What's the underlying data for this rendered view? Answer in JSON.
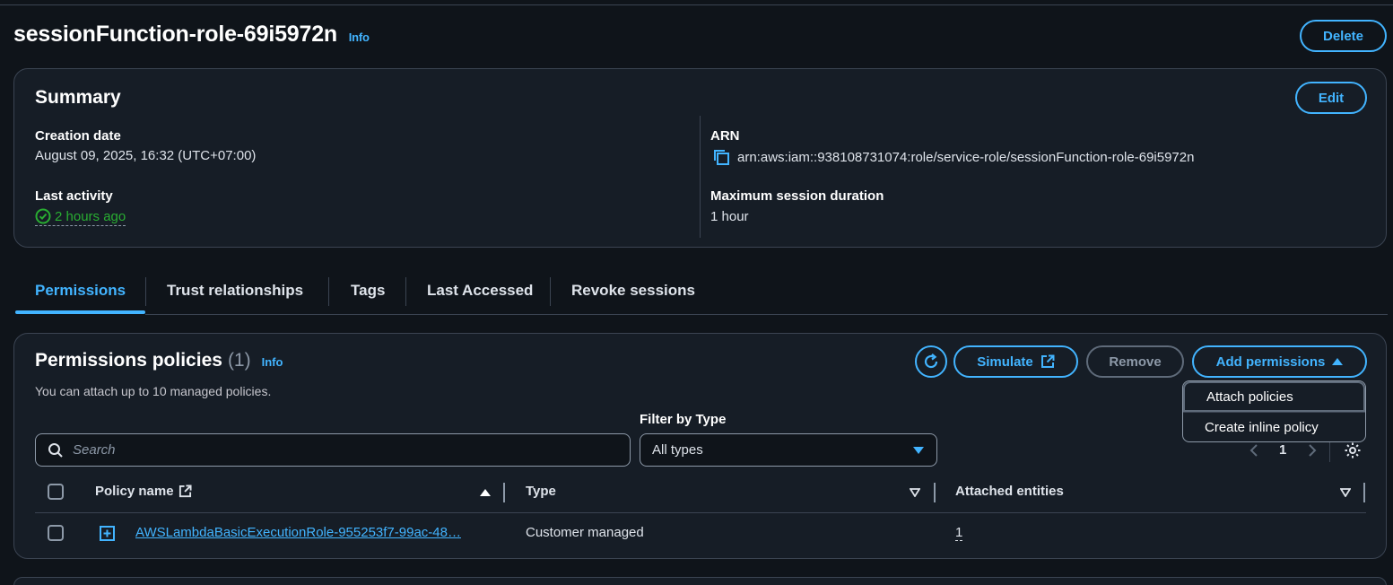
{
  "page": {
    "title": "sessionFunction-role-69i5972n",
    "info": "Info",
    "delete_label": "Delete"
  },
  "summary": {
    "title": "Summary",
    "edit_label": "Edit",
    "creation_date_label": "Creation date",
    "creation_date_value": "August 09, 2025, 16:32 (UTC+07:00)",
    "last_activity_label": "Last activity",
    "last_activity_value": "2 hours ago",
    "arn_label": "ARN",
    "arn_value": "arn:aws:iam::938108731074:role/service-role/sessionFunction-role-69i5972n",
    "max_session_label": "Maximum session duration",
    "max_session_value": "1 hour"
  },
  "tabs": [
    {
      "label": "Permissions",
      "active": true
    },
    {
      "label": "Trust relationships"
    },
    {
      "label": "Tags"
    },
    {
      "label": "Last Accessed"
    },
    {
      "label": "Revoke sessions"
    }
  ],
  "policies": {
    "title": "Permissions policies",
    "count": "(1)",
    "info": "Info",
    "description": "You can attach up to 10 managed policies.",
    "simulate_label": "Simulate",
    "remove_label": "Remove",
    "add_permissions_label": "Add permissions",
    "filter_label": "Filter by Type",
    "filter_value": "All types",
    "search_placeholder": "Search",
    "page_number": "1",
    "columns": {
      "name": "Policy name",
      "type": "Type",
      "attached": "Attached entities"
    },
    "rows": [
      {
        "name": "AWSLambdaBasicExecutionRole-955253f7-99ac-48…",
        "type": "Customer managed",
        "attached": "1"
      }
    ]
  },
  "dropdown": {
    "items": [
      "Attach policies",
      "Create inline policy"
    ]
  },
  "colors": {
    "accent": "#42b4ff",
    "success": "#29ad32",
    "background": "#0f141a",
    "panel": "#161d26"
  }
}
